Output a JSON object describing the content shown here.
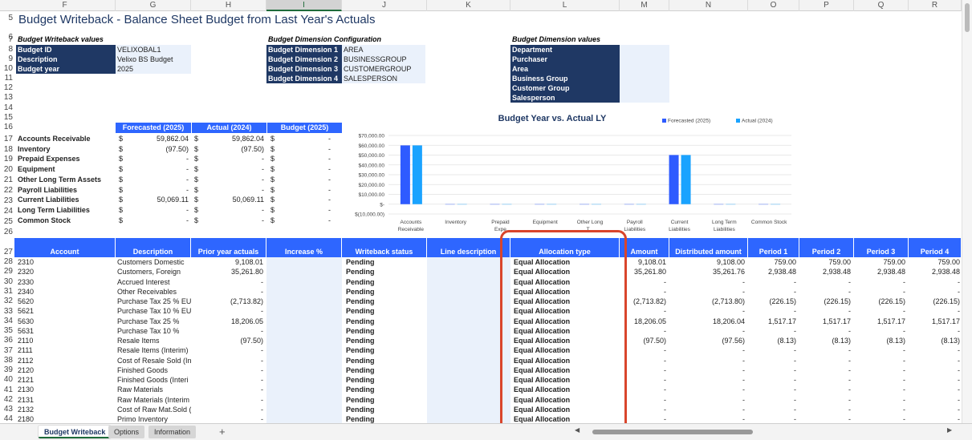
{
  "columns": [
    "F",
    "G",
    "H",
    "I",
    "J",
    "K",
    "L",
    "M",
    "N",
    "O",
    "P",
    "Q",
    "R"
  ],
  "row_numbers": [
    "5",
    "6",
    "7",
    "8",
    "9",
    "10",
    "11",
    "12",
    "13",
    "14",
    "15",
    "16",
    "17",
    "18",
    "19",
    "20",
    "21",
    "22",
    "23",
    "24",
    "25",
    "26",
    "27",
    "28",
    "29",
    "30",
    "31",
    "32",
    "33",
    "34",
    "35",
    "36",
    "37",
    "38",
    "39",
    "40",
    "41",
    "42",
    "43",
    "44"
  ],
  "title": "Budget Writeback - Balance Sheet Budget from Last Year's Actuals",
  "writeback_values": {
    "heading": "Budget Writeback values",
    "rows": [
      {
        "label": "Budget ID",
        "value": "VELIXOBAL1"
      },
      {
        "label": "Description",
        "value": "Velixo BS Budget"
      },
      {
        "label": "Budget year",
        "value": "2025"
      }
    ]
  },
  "dimension_config": {
    "heading": "Budget Dimension Configuration",
    "rows": [
      {
        "label": "Budget Dimension 1",
        "value": "AREA"
      },
      {
        "label": "Budget Dimension 2",
        "value": "BUSINESSGROUP"
      },
      {
        "label": "Budget Dimension 3",
        "value": "CUSTOMERGROUP"
      },
      {
        "label": "Budget Dimension 4",
        "value": "SALESPERSON"
      }
    ]
  },
  "dimension_values": {
    "heading": "Budget Dimension values",
    "rows": [
      "Department",
      "Purchaser",
      "Area",
      "Business Group",
      "Customer Group",
      "Salesperson"
    ]
  },
  "summary": {
    "headers": [
      "Forecasted (2025)",
      "Actual (2024)",
      "Budget (2025)"
    ],
    "currency": "$",
    "rows": [
      {
        "label": "Accounts Receivable",
        "forecast": "59,862.04",
        "actual": "59,862.04",
        "budget": "-"
      },
      {
        "label": "Inventory",
        "forecast": "(97.50)",
        "actual": "(97.50)",
        "budget": "-"
      },
      {
        "label": "Prepaid Expenses",
        "forecast": "-",
        "actual": "-",
        "budget": "-"
      },
      {
        "label": "Equipment",
        "forecast": "-",
        "actual": "-",
        "budget": "-"
      },
      {
        "label": "Other Long Term Assets",
        "forecast": "-",
        "actual": "-",
        "budget": "-"
      },
      {
        "label": "Payroll Liabilities",
        "forecast": "-",
        "actual": "-",
        "budget": "-"
      },
      {
        "label": "Current Liabilities",
        "forecast": "50,069.11",
        "actual": "50,069.11",
        "budget": "-"
      },
      {
        "label": "Long Term Liabilities",
        "forecast": "-",
        "actual": "-",
        "budget": "-"
      },
      {
        "label": "Common Stock",
        "forecast": "-",
        "actual": "-",
        "budget": "-"
      }
    ]
  },
  "chart_data": {
    "type": "bar",
    "title": "Budget Year vs. Actual LY",
    "categories": [
      "Accounts Receivable",
      "Inventory",
      "Prepaid Expenses",
      "Equipment",
      "Other Long Term Assets",
      "Payroll Liabilities",
      "Current Liabilities",
      "Long Term Liabilities",
      "Common Stock"
    ],
    "category_labels": [
      [
        "Accounts",
        "Receivable"
      ],
      [
        "Inventory"
      ],
      [
        "Prepaid",
        "Expe"
      ],
      [
        "Equipment"
      ],
      [
        "Other Long",
        "T..."
      ],
      [
        "Payroll",
        "Liabilities"
      ],
      [
        "Current",
        "Liabilities"
      ],
      [
        "Long Term",
        "Liabilities"
      ],
      [
        "Common Stock"
      ]
    ],
    "series": [
      {
        "name": "Forecasted (2025)",
        "color": "#2e5bff",
        "values": [
          59862.04,
          -97.5,
          0,
          0,
          0,
          0,
          50069.11,
          0,
          0
        ]
      },
      {
        "name": "Actual (2024)",
        "color": "#1aa3ff",
        "values": [
          59862.04,
          -97.5,
          0,
          0,
          0,
          0,
          50069.11,
          0,
          0
        ]
      }
    ],
    "yticks": [
      "$70,000.00",
      "$60,000.00",
      "$50,000.00",
      "$40,000.00",
      "$30,000.00",
      "$20,000.00",
      "$10,000.00",
      "$-",
      "$(10,000.00)"
    ],
    "ytick_values": [
      70000,
      60000,
      50000,
      40000,
      30000,
      20000,
      10000,
      0,
      -10000
    ],
    "ylim": [
      -10000,
      70000
    ],
    "grid": true,
    "legend": "top-right"
  },
  "main_table": {
    "headers": [
      "Account",
      "Description",
      "Prior year actuals",
      "Increase %",
      "Writeback status",
      "Line description",
      "Allocation type",
      "Amount",
      "Distributed amount",
      "Period 1",
      "Period 2",
      "Period 3",
      "Period 4"
    ],
    "rows": [
      {
        "account": "2310",
        "desc": "Customers Domestic",
        "prior": "9,108.01",
        "status": "Pending",
        "alloc": "Equal Allocation",
        "amount": "9,108.01",
        "dist": "9,108.00",
        "p1": "759.00",
        "p2": "759.00",
        "p3": "759.00",
        "p4": "759.00"
      },
      {
        "account": "2320",
        "desc": "Customers, Foreign",
        "prior": "35,261.80",
        "status": "Pending",
        "alloc": "Equal Allocation",
        "amount": "35,261.80",
        "dist": "35,261.76",
        "p1": "2,938.48",
        "p2": "2,938.48",
        "p3": "2,938.48",
        "p4": "2,938.48"
      },
      {
        "account": "2330",
        "desc": "Accrued Interest",
        "prior": "-",
        "status": "Pending",
        "alloc": "Equal Allocation",
        "amount": "-",
        "dist": "-",
        "p1": "-",
        "p2": "-",
        "p3": "-",
        "p4": "-"
      },
      {
        "account": "2340",
        "desc": "Other Receivables",
        "prior": "-",
        "status": "Pending",
        "alloc": "Equal Allocation",
        "amount": "-",
        "dist": "-",
        "p1": "-",
        "p2": "-",
        "p3": "-",
        "p4": "-"
      },
      {
        "account": "5620",
        "desc": "Purchase Tax 25 % EU",
        "prior": "(2,713.82)",
        "status": "Pending",
        "alloc": "Equal Allocation",
        "amount": "(2,713.82)",
        "dist": "(2,713.80)",
        "p1": "(226.15)",
        "p2": "(226.15)",
        "p3": "(226.15)",
        "p4": "(226.15)"
      },
      {
        "account": "5621",
        "desc": "Purchase Tax 10 % EU",
        "prior": "-",
        "status": "Pending",
        "alloc": "Equal Allocation",
        "amount": "-",
        "dist": "-",
        "p1": "-",
        "p2": "-",
        "p3": "-",
        "p4": "-"
      },
      {
        "account": "5630",
        "desc": "Purchase Tax 25 %",
        "prior": "18,206.05",
        "status": "Pending",
        "alloc": "Equal Allocation",
        "amount": "18,206.05",
        "dist": "18,206.04",
        "p1": "1,517.17",
        "p2": "1,517.17",
        "p3": "1,517.17",
        "p4": "1,517.17"
      },
      {
        "account": "5631",
        "desc": "Purchase Tax 10 %",
        "prior": "-",
        "status": "Pending",
        "alloc": "Equal Allocation",
        "amount": "-",
        "dist": "-",
        "p1": "-",
        "p2": "-",
        "p3": "-",
        "p4": "-"
      },
      {
        "account": "2110",
        "desc": "Resale Items",
        "prior": "(97.50)",
        "status": "Pending",
        "alloc": "Equal Allocation",
        "amount": "(97.50)",
        "dist": "(97.56)",
        "p1": "(8.13)",
        "p2": "(8.13)",
        "p3": "(8.13)",
        "p4": "(8.13)"
      },
      {
        "account": "2111",
        "desc": "Resale Items (Interim)",
        "prior": "-",
        "status": "Pending",
        "alloc": "Equal Allocation",
        "amount": "-",
        "dist": "-",
        "p1": "-",
        "p2": "-",
        "p3": "-",
        "p4": "-"
      },
      {
        "account": "2112",
        "desc": "Cost of Resale Sold (In",
        "prior": "-",
        "status": "Pending",
        "alloc": "Equal Allocation",
        "amount": "-",
        "dist": "-",
        "p1": "-",
        "p2": "-",
        "p3": "-",
        "p4": "-"
      },
      {
        "account": "2120",
        "desc": "Finished Goods",
        "prior": "-",
        "status": "Pending",
        "alloc": "Equal Allocation",
        "amount": "-",
        "dist": "-",
        "p1": "-",
        "p2": "-",
        "p3": "-",
        "p4": "-"
      },
      {
        "account": "2121",
        "desc": "Finished Goods (Interi",
        "prior": "-",
        "status": "Pending",
        "alloc": "Equal Allocation",
        "amount": "-",
        "dist": "-",
        "p1": "-",
        "p2": "-",
        "p3": "-",
        "p4": "-"
      },
      {
        "account": "2130",
        "desc": "Raw Materials",
        "prior": "-",
        "status": "Pending",
        "alloc": "Equal Allocation",
        "amount": "-",
        "dist": "-",
        "p1": "-",
        "p2": "-",
        "p3": "-",
        "p4": "-"
      },
      {
        "account": "2131",
        "desc": "Raw Materials (Interim",
        "prior": "-",
        "status": "Pending",
        "alloc": "Equal Allocation",
        "amount": "-",
        "dist": "-",
        "p1": "-",
        "p2": "-",
        "p3": "-",
        "p4": "-"
      },
      {
        "account": "2132",
        "desc": "Cost of Raw Mat.Sold (",
        "prior": "-",
        "status": "Pending",
        "alloc": "Equal Allocation",
        "amount": "-",
        "dist": "-",
        "p1": "-",
        "p2": "-",
        "p3": "-",
        "p4": "-"
      },
      {
        "account": "2180",
        "desc": "Primo Inventory",
        "prior": "-",
        "status": "Pending",
        "alloc": "Equal Allocation",
        "amount": "-",
        "dist": "-",
        "p1": "-",
        "p2": "-",
        "p3": "-",
        "p4": "-"
      }
    ]
  },
  "tabs": [
    {
      "label": "Budget Writeback",
      "active": true
    },
    {
      "label": "Options",
      "active": false
    },
    {
      "label": "Information",
      "active": false
    }
  ],
  "add_sheet_label": "+",
  "highlight_color": "#d9452c"
}
